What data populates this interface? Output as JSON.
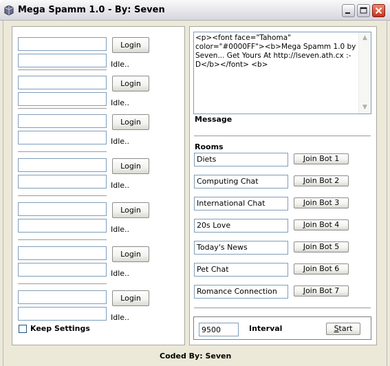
{
  "window": {
    "title": "Mega Spamm 1.0 - By: Seven",
    "footer": "Coded By: Seven"
  },
  "accounts": [
    {
      "user": "",
      "pass": "",
      "login_label": "Login",
      "status": "Idle.."
    },
    {
      "user": "",
      "pass": "",
      "login_label": "Login",
      "status": "Idle.."
    },
    {
      "user": "",
      "pass": "",
      "login_label": "Login",
      "status": "Idle.."
    },
    {
      "user": "",
      "pass": "",
      "login_label": "Login",
      "status": "Idle.."
    },
    {
      "user": "",
      "pass": "",
      "login_label": "Login",
      "status": "Idle.."
    },
    {
      "user": "",
      "pass": "",
      "login_label": "Login",
      "status": "Idle.."
    },
    {
      "user": "",
      "pass": "",
      "login_label": "Login",
      "status": "Idle.."
    }
  ],
  "keep_settings": {
    "label": "Keep Settings",
    "checked": false
  },
  "message": {
    "label": "Message",
    "text": "<p><font face=\"Tahoma\" color=\"#0000FF\"><b>Mega Spamm 1.0 by Seven... Get Yours At http://lseven.ath.cx :-D</b></font> <b>"
  },
  "rooms": {
    "label": "Rooms",
    "items": [
      {
        "name": "Diets",
        "button": "Join Bot 1",
        "hotkey": "J",
        "rest": "oin Bot 1"
      },
      {
        "name": "Computing Chat",
        "button": "Join Bot 2",
        "hotkey": "J",
        "rest": "oin Bot 2"
      },
      {
        "name": "International Chat",
        "button": "Join Bot 3",
        "hotkey": "J",
        "rest": "oin Bot 3"
      },
      {
        "name": "20s Love",
        "button": "Join Bot 4",
        "hotkey": "J",
        "rest": "oin Bot 4"
      },
      {
        "name": "Today's News",
        "button": "Join Bot 5",
        "hotkey": "J",
        "rest": "oin Bot 5"
      },
      {
        "name": "Pet Chat",
        "button": "Join Bot 6",
        "hotkey": "J",
        "rest": "oin Bot 6"
      },
      {
        "name": "Romance Connection",
        "button": "Join Bot 7",
        "hotkey": "J",
        "rest": "oin Bot 7"
      }
    ]
  },
  "interval": {
    "value": "9500",
    "label": "Interval"
  },
  "start": {
    "label": "Start",
    "hotkey": "S",
    "rest": "tart"
  },
  "icons": {
    "app": "app-icon",
    "minimize": "minimize-icon",
    "maximize": "maximize-icon",
    "close": "close-icon"
  },
  "colors": {
    "close_button": "#c8321a",
    "window_face": "#ece9d8"
  }
}
